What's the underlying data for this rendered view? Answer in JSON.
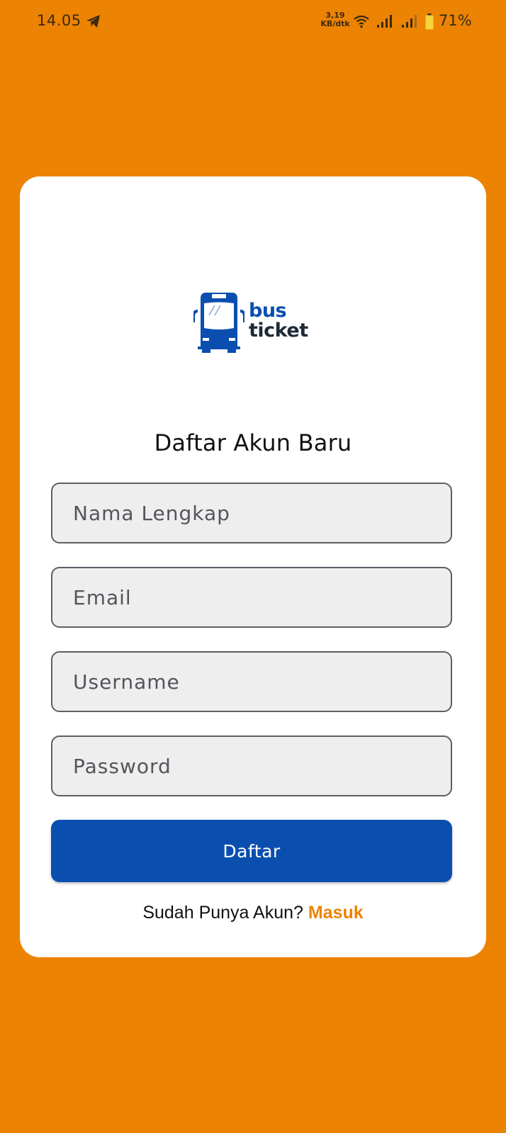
{
  "status_bar": {
    "time": "14.05",
    "net_speed_value": "3,19",
    "net_speed_unit": "KB/dtk",
    "battery_percent": "71%",
    "icons": [
      "telegram-icon",
      "wifi-icon",
      "signal-icon",
      "signal-icon",
      "battery-icon"
    ]
  },
  "logo": {
    "word1": "bus",
    "word2": "ticket",
    "icon": "bus-icon"
  },
  "form": {
    "title": "Daftar Akun Baru",
    "fields": [
      {
        "name": "nama-lengkap",
        "placeholder": "Nama Lengkap",
        "value": ""
      },
      {
        "name": "email",
        "placeholder": "Email",
        "value": ""
      },
      {
        "name": "username",
        "placeholder": "Username",
        "value": ""
      },
      {
        "name": "password",
        "placeholder": "Password",
        "value": ""
      }
    ],
    "submit_label": "Daftar",
    "login_prompt": "Sudah Punya Akun?",
    "login_link": "Masuk"
  },
  "colors": {
    "background": "#EC8303",
    "card": "#FFFFFF",
    "primary": "#0A4FAF",
    "field_bg": "#EEEEEE",
    "link": "#EC8303"
  }
}
